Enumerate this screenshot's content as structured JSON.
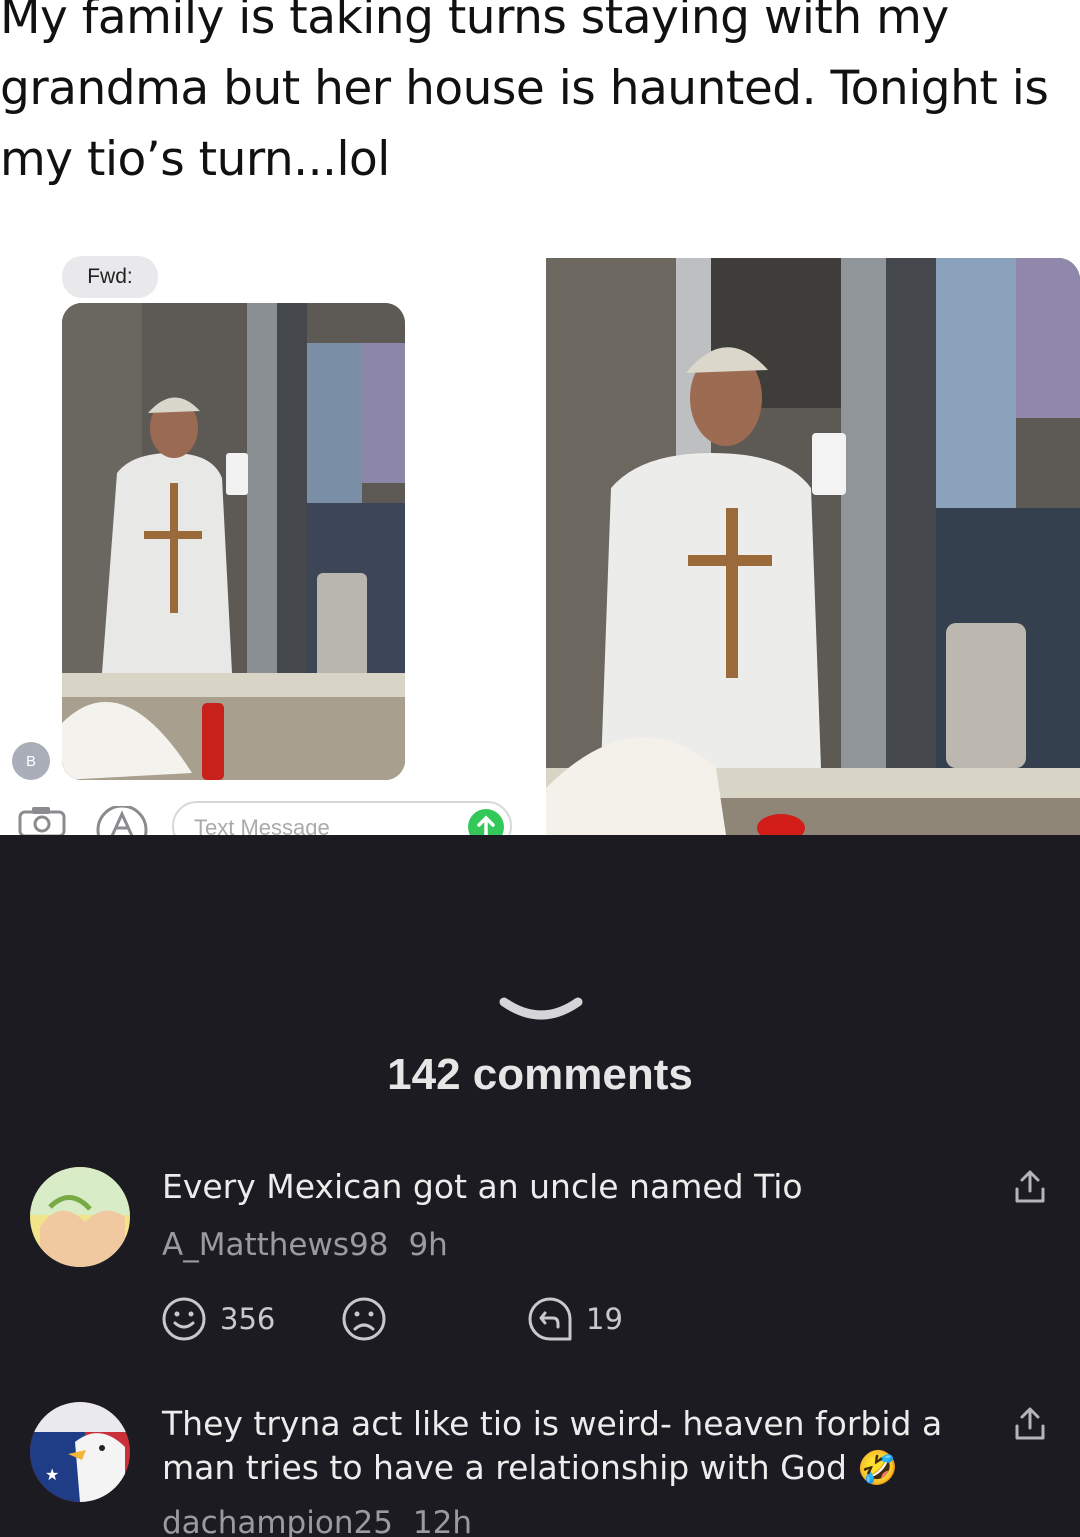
{
  "post": {
    "text_lines": [
      "My family is taking turns staying with my",
      "grandma but her house is haunted. Tonight is",
      "my tio’s turn...lol"
    ],
    "imessage": {
      "fwd_label": "Fwd:",
      "contact_initial": "B",
      "input_placeholder": "Text Message"
    }
  },
  "comments_section": {
    "count_label": "142 comments",
    "comments": [
      {
        "text": "Every Mexican got an uncle named Tio",
        "user": "A_Matthews98",
        "age": "9h",
        "upvotes": "356",
        "replies": "19"
      },
      {
        "text_line1": "They tryna act like tio is weird- heaven forbid a",
        "text_line2": "man tries to have a relationship with God 🤣",
        "user": "dachampion25",
        "age": "12h"
      }
    ]
  },
  "colors": {
    "background": "#1b1b21",
    "post_background": "#ffffff",
    "send_button": "#34c759"
  }
}
